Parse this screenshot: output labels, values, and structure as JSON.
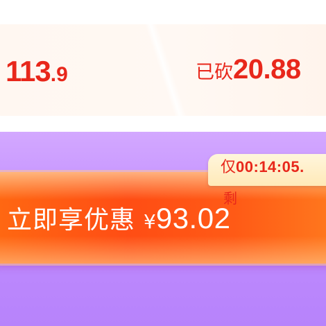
{
  "price_card": {
    "current_price_main": "113",
    "current_price_decimal": ".9",
    "cut_label": "已砍",
    "cut_amount": "20.88"
  },
  "cta": {
    "label": "立即享优惠",
    "currency": "¥",
    "price": "93.02"
  },
  "countdown": {
    "prefix": "仅",
    "time": "00:14:05.",
    "suffix": "剩"
  },
  "colors": {
    "price_red": "#e8271b",
    "cta_orange": "#ff5314",
    "purple": "#c08cff",
    "cream": "#fff7f1",
    "tag_yellow": "#ffeec6"
  }
}
